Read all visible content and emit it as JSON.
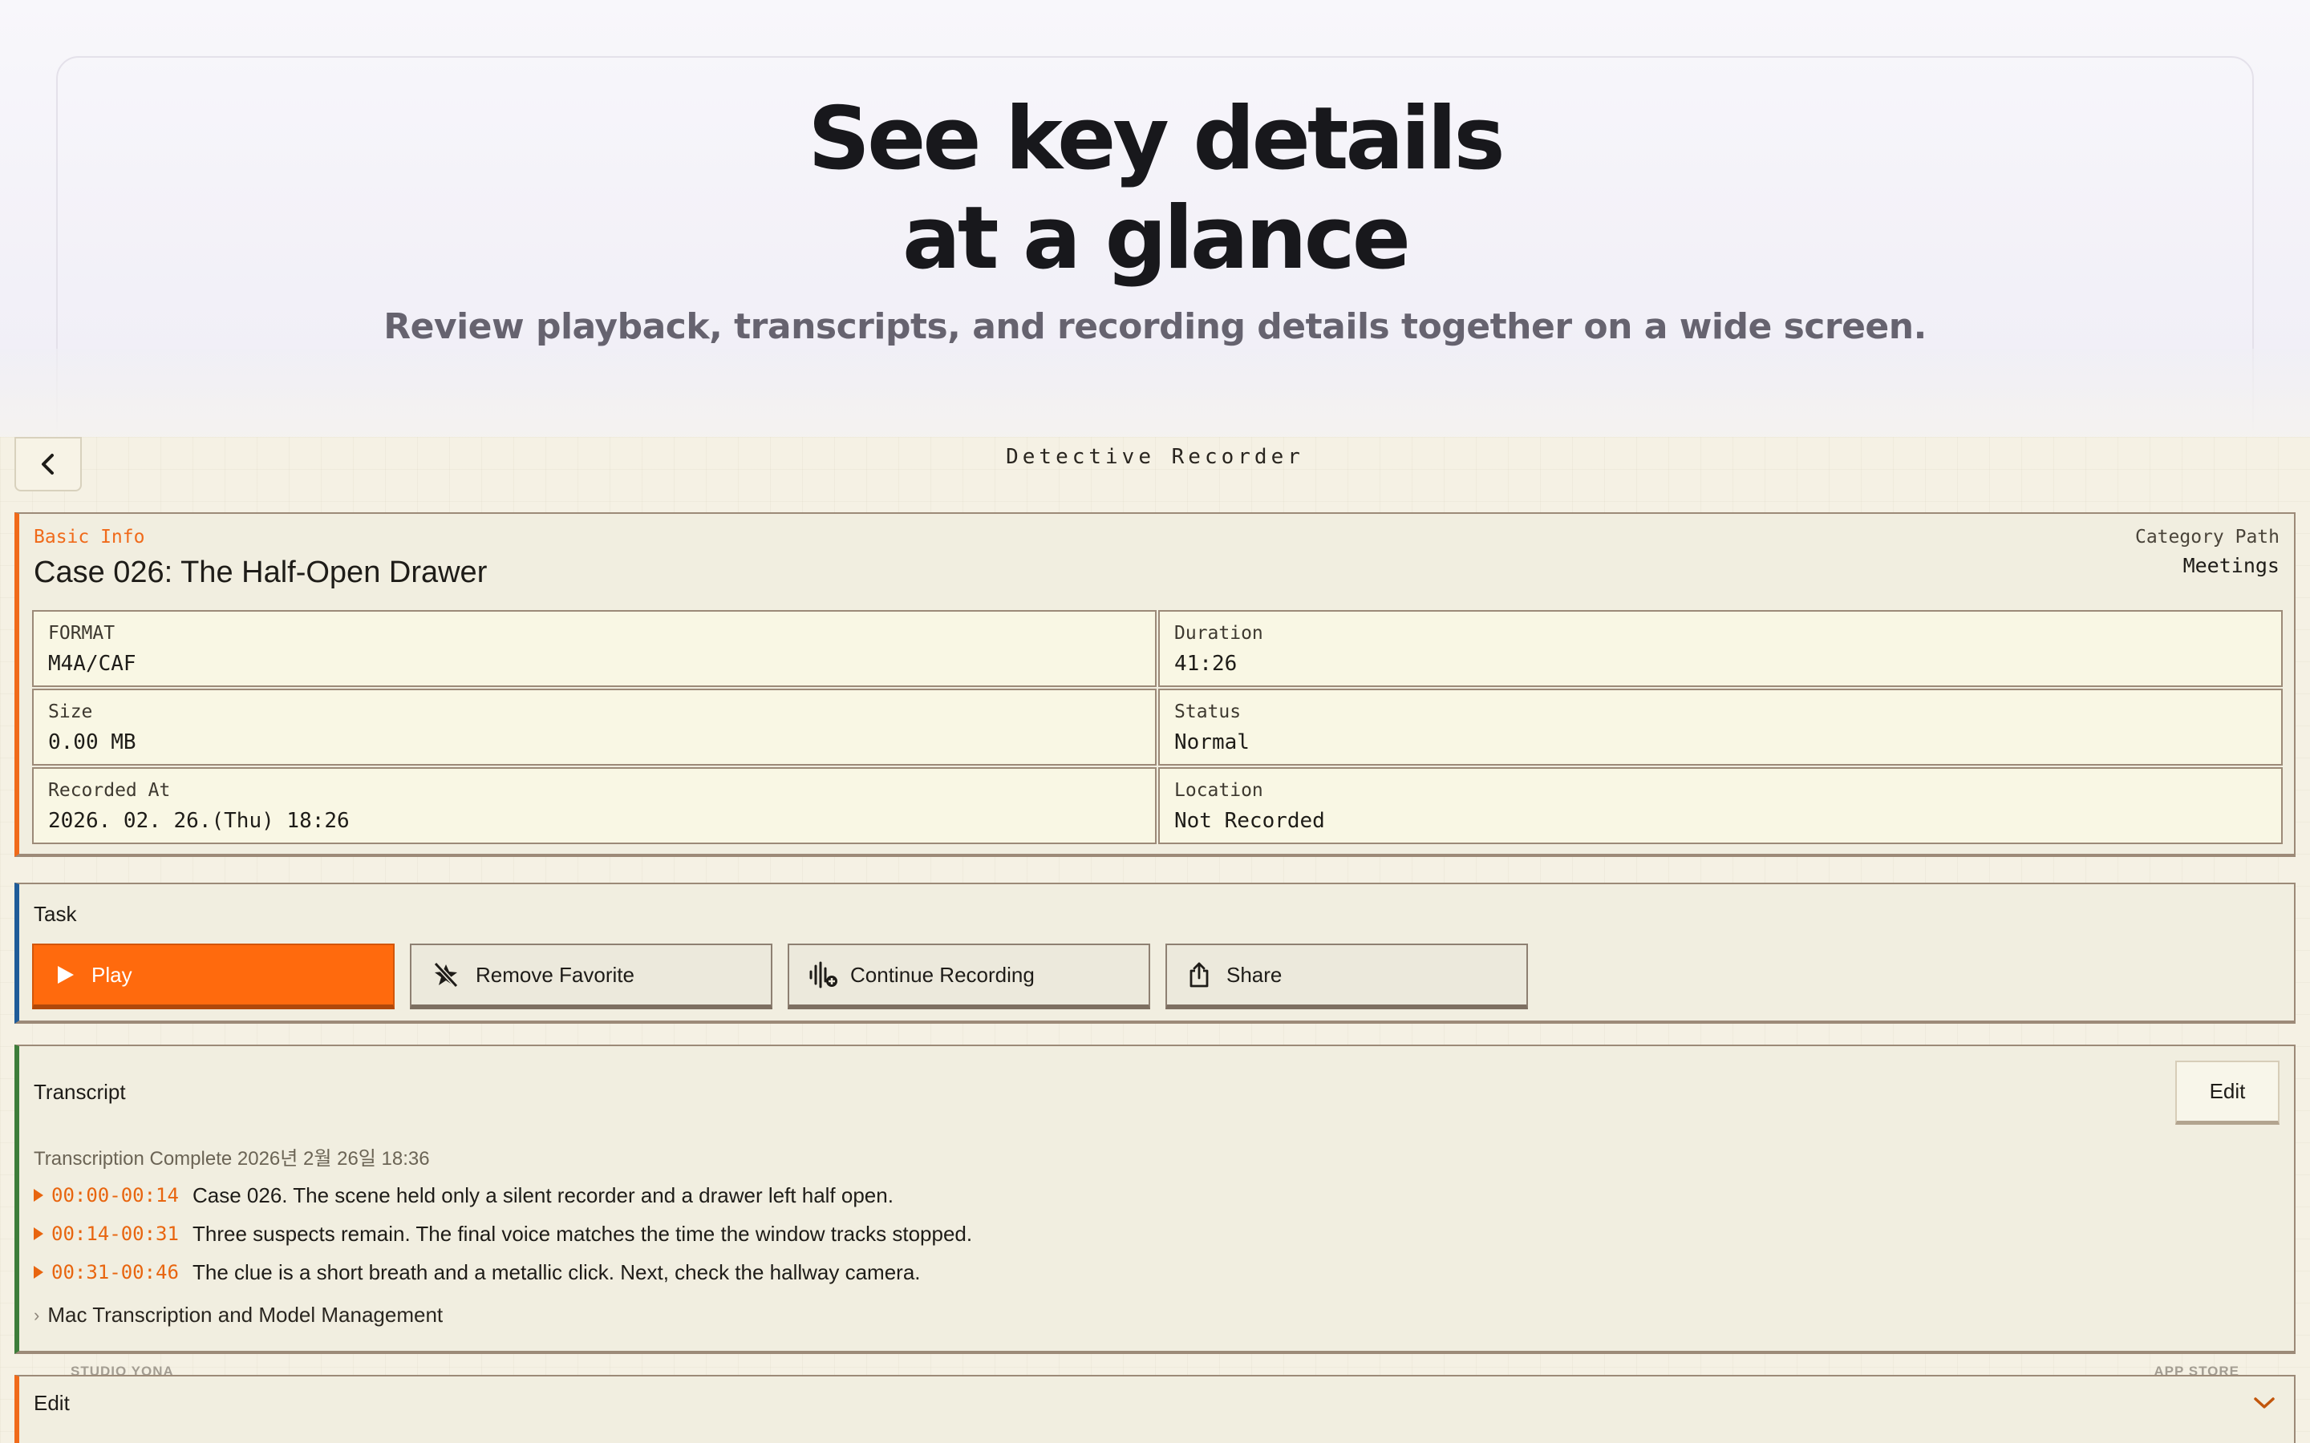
{
  "hero": {
    "title_line1": "See key details",
    "title_line2": "at a glance",
    "subtitle": "Review playback, transcripts, and recording details together on a wide screen."
  },
  "app": {
    "title": "Detective Recorder",
    "back_icon": "chevron-left-icon"
  },
  "basic_info": {
    "section_label": "Basic Info",
    "case_title": "Case 026: The Half-Open Drawer",
    "category_label": "Category Path",
    "category_value": "Meetings",
    "fields": [
      {
        "key": "FORMAT",
        "value": "M4A/CAF"
      },
      {
        "key": "Duration",
        "value": "41:26"
      },
      {
        "key": "Size",
        "value": "0.00 MB"
      },
      {
        "key": "Status",
        "value": "Normal"
      },
      {
        "key": "Recorded At",
        "value": "2026. 02. 26.(Thu) 18:26"
      },
      {
        "key": "Location",
        "value": "Not Recorded"
      }
    ]
  },
  "task": {
    "heading": "Task",
    "buttons": [
      {
        "label": "Play",
        "icon": "play-icon"
      },
      {
        "label": "Remove Favorite",
        "icon": "star-slash-icon"
      },
      {
        "label": "Continue Recording",
        "icon": "waveform-plus-icon"
      },
      {
        "label": "Share",
        "icon": "share-icon"
      }
    ]
  },
  "transcript": {
    "heading": "Transcript",
    "edit_label": "Edit",
    "status": "Transcription Complete 2026년 2월 26일 18:36",
    "segments": [
      {
        "time": "00:00-00:14",
        "text": "Case 026. The scene held only a silent recorder and a drawer left half open."
      },
      {
        "time": "00:14-00:31",
        "text": "Three suspects remain. The final voice matches the time the window tracks stopped."
      },
      {
        "time": "00:31-00:46",
        "text": "The clue is a short breath and a metallic click. Next, check the hallway camera."
      }
    ],
    "mac_section": "Mac Transcription and Model Management"
  },
  "edit_section": {
    "title": "Edit",
    "chevron_icon": "chevron-down-icon"
  },
  "footer": {
    "left": "STUDIO YONA",
    "right": "APP STORE"
  },
  "colors": {
    "accent_orange": "#ff6a0d",
    "task_accent": "#1f5c99",
    "transcript_accent": "#3d7d3a",
    "panel_bg": "#f1eee0"
  }
}
